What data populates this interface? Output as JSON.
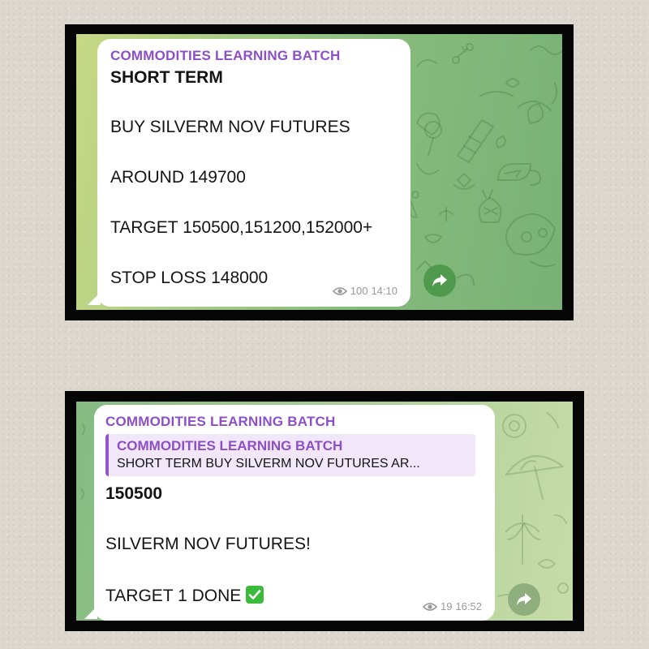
{
  "messages": [
    {
      "sender": "COMMODITIES LEARNING BATCH",
      "lines": {
        "title": "SHORT TERM",
        "l1": "BUY SILVERM NOV FUTURES",
        "l2": "AROUND 149700",
        "l3": "TARGET 150500,151200,152000+",
        "l4": "STOP LOSS 148000"
      },
      "views": "100",
      "time": "14:10",
      "share_icon": "share-arrow-icon"
    },
    {
      "sender": "COMMODITIES LEARNING BATCH",
      "reply": {
        "sender": "COMMODITIES LEARNING BATCH",
        "text": "SHORT TERM BUY SILVERM NOV FUTURES AR..."
      },
      "lines": {
        "title": "150500",
        "l1": "SILVERM NOV FUTURES!",
        "l2": "TARGET 1 DONE"
      },
      "emoji": "check-mark-button-icon",
      "views": "19",
      "time": "16:52",
      "share_icon": "share-arrow-icon"
    }
  ],
  "colors": {
    "sender": "#8c4fc8",
    "reply_bg": "#f1e7f8",
    "share_button_1": "#4f9a4c",
    "share_button_2": "#8fae7d",
    "check_emoji": "#3cba3c"
  }
}
